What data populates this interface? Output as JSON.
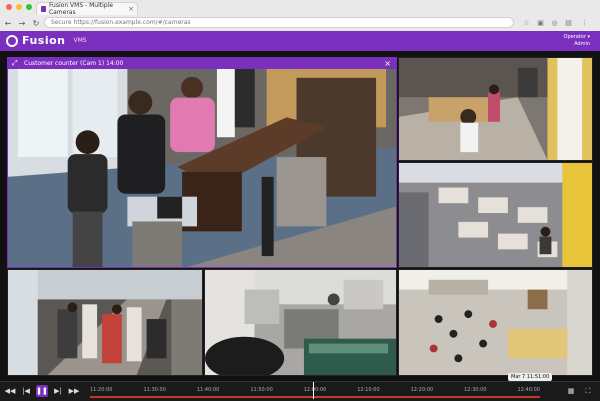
{
  "browser": {
    "tab_title": "Fusion VMS - Multiple Cameras",
    "url": "Secure  https://fusion.example.com/#/cameras",
    "traffic_colors": [
      "#ff5f57",
      "#febc2e",
      "#28c840"
    ]
  },
  "app": {
    "name": "Fusion",
    "subtitle": "VMS",
    "user_line1": "Operator ▾",
    "user_line2": "Admin",
    "accent": "#7b2fbe"
  },
  "main_camera": {
    "title": "Customer counter (Cam 1)  14:00"
  },
  "timeline": {
    "ticks": [
      "11:20:00",
      "11:30:00",
      "11:40:00",
      "11:50:00",
      "12:00:00",
      "12:10:00",
      "12:20:00",
      "12:30:00",
      "12:40:00"
    ],
    "cursor_label": "Mar 7  11:51:00",
    "progress_color": "#c0392b"
  }
}
